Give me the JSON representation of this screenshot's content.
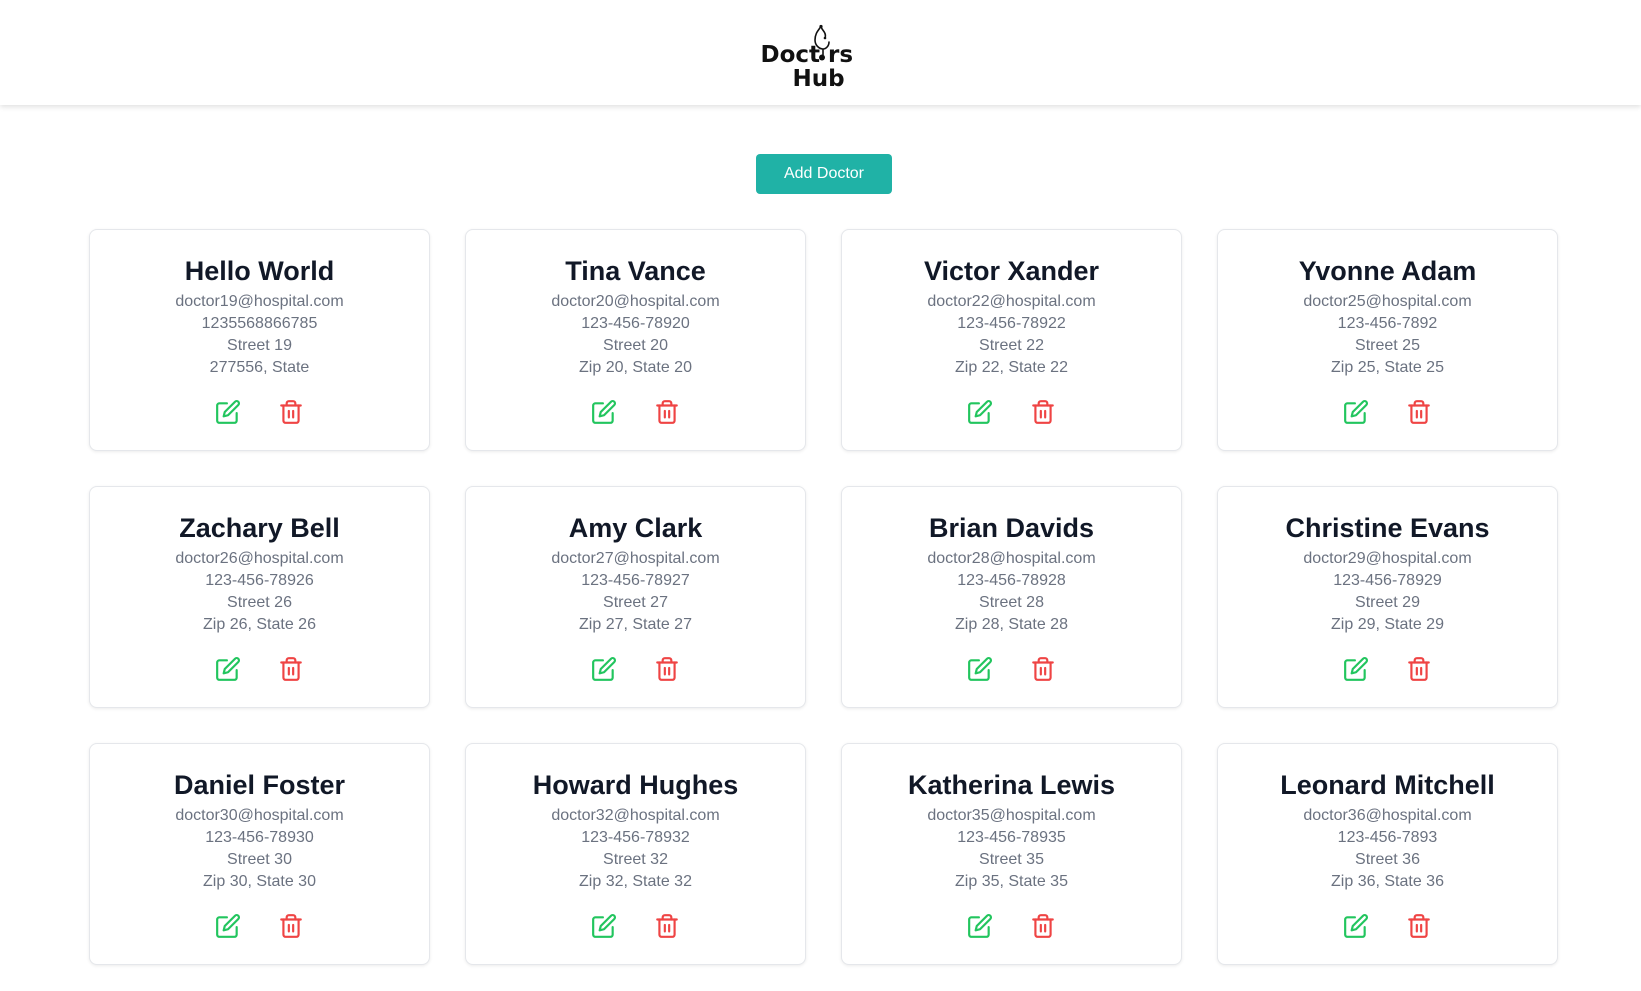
{
  "brand": {
    "line1": "Doct rs",
    "line2": "Hub",
    "logo_icon": "stethoscope-icon"
  },
  "actions": {
    "add_doctor_label": "Add Doctor"
  },
  "colors": {
    "accent": "#20b2a6",
    "edit": "#22c55e",
    "delete": "#ef4444"
  },
  "doctors": [
    {
      "name": "Hello World",
      "email": "doctor19@hospital.com",
      "phone": "1235568866785",
      "street": "Street 19",
      "location": "277556, State"
    },
    {
      "name": "Tina Vance",
      "email": "doctor20@hospital.com",
      "phone": "123-456-78920",
      "street": "Street 20",
      "location": "Zip 20, State 20"
    },
    {
      "name": "Victor Xander",
      "email": "doctor22@hospital.com",
      "phone": "123-456-78922",
      "street": "Street 22",
      "location": "Zip 22, State 22"
    },
    {
      "name": "Yvonne Adam",
      "email": "doctor25@hospital.com",
      "phone": "123-456-7892",
      "street": "Street 25",
      "location": "Zip 25, State 25"
    },
    {
      "name": "Zachary Bell",
      "email": "doctor26@hospital.com",
      "phone": "123-456-78926",
      "street": "Street 26",
      "location": "Zip 26, State 26"
    },
    {
      "name": "Amy Clark",
      "email": "doctor27@hospital.com",
      "phone": "123-456-78927",
      "street": "Street 27",
      "location": "Zip 27, State 27"
    },
    {
      "name": "Brian Davids",
      "email": "doctor28@hospital.com",
      "phone": "123-456-78928",
      "street": "Street 28",
      "location": "Zip 28, State 28"
    },
    {
      "name": "Christine Evans",
      "email": "doctor29@hospital.com",
      "phone": "123-456-78929",
      "street": "Street 29",
      "location": "Zip 29, State 29"
    },
    {
      "name": "Daniel Foster",
      "email": "doctor30@hospital.com",
      "phone": "123-456-78930",
      "street": "Street 30",
      "location": "Zip 30, State 30"
    },
    {
      "name": "Howard Hughes",
      "email": "doctor32@hospital.com",
      "phone": "123-456-78932",
      "street": "Street 32",
      "location": "Zip 32, State 32"
    },
    {
      "name": "Katherina Lewis",
      "email": "doctor35@hospital.com",
      "phone": "123-456-78935",
      "street": "Street 35",
      "location": "Zip 35, State 35"
    },
    {
      "name": "Leonard Mitchell",
      "email": "doctor36@hospital.com",
      "phone": "123-456-7893",
      "street": "Street 36",
      "location": "Zip 36, State 36"
    }
  ]
}
